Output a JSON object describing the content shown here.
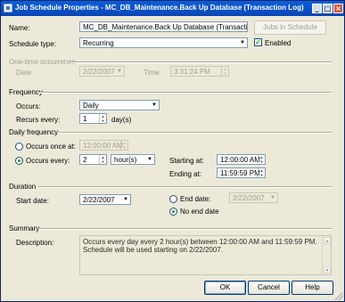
{
  "window": {
    "title": "Job Schedule Properties - MC_DB_Maintenance.Back Up Database (Transaction Log)",
    "min_glyph": "_",
    "max_glyph": "□",
    "close_glyph": "×"
  },
  "name": {
    "label": "Name:",
    "value": "MC_DB_Maintenance.Back Up Database (Transaction Log)",
    "jobs_button": "Jobs in Schedule"
  },
  "schedule_type": {
    "label": "Schedule type:",
    "value": "Recurring",
    "enabled_label": "Enabled",
    "enabled": true
  },
  "one_time": {
    "header": "One-time occurrence",
    "date_label": "Date:",
    "date_value": "2/22/2007",
    "time_label": "Time:",
    "time_value": "3:31:24 PM"
  },
  "frequency": {
    "header": "Frequency",
    "occurs_label": "Occurs:",
    "occurs_value": "Daily",
    "recurs_label": "Recurs every:",
    "recurs_value": "1",
    "recurs_unit": "day(s)"
  },
  "daily": {
    "header": "Daily frequency",
    "once_label": "Occurs once at:",
    "once_value": "12:00:00 AM",
    "every_label": "Occurs every:",
    "every_value": "2",
    "every_unit": "hour(s)",
    "starting_label": "Starting at:",
    "starting_value": "12:00:00 AM",
    "ending_label": "Ending at:",
    "ending_value": "11:59:59 PM"
  },
  "duration": {
    "header": "Duration",
    "start_label": "Start date:",
    "start_value": "2/22/2007",
    "end_label": "End date:",
    "end_value": "2/22/2007",
    "no_end_label": "No end date"
  },
  "summary": {
    "header": "Summary",
    "desc_label": "Description:",
    "desc_text": "Occurs every day every 2 hour(s) between 12:00:00 AM and 11:59:59 PM. Schedule will be used starting on 2/22/2007."
  },
  "buttons": {
    "ok": "OK",
    "cancel": "Cancel",
    "help": "Help"
  }
}
